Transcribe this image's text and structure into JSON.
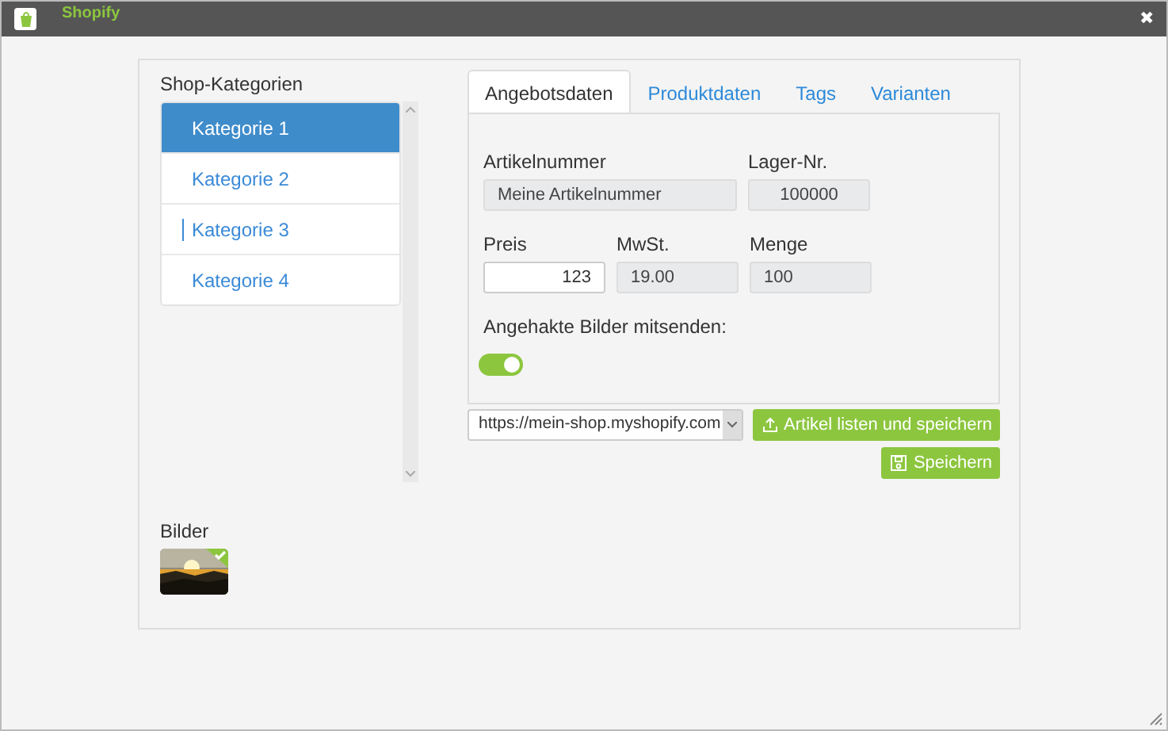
{
  "window": {
    "title": "Shopify",
    "close": "✖"
  },
  "categories": {
    "title": "Shop-Kategorien",
    "items": [
      {
        "label": "Kategorie 1",
        "selected": true,
        "cursor": false
      },
      {
        "label": "Kategorie 2",
        "selected": false,
        "cursor": false
      },
      {
        "label": "Kategorie 3",
        "selected": false,
        "cursor": true
      },
      {
        "label": "Kategorie 4",
        "selected": false,
        "cursor": false
      }
    ]
  },
  "images": {
    "title": "Bilder",
    "items": [
      {
        "kind": "picture",
        "checked": true
      }
    ]
  },
  "tabs": [
    {
      "label": "Angebotsdaten",
      "selected": true
    },
    {
      "label": "Produktdaten",
      "selected": false
    },
    {
      "label": "Tags",
      "selected": false
    },
    {
      "label": "Varianten",
      "selected": false
    }
  ],
  "fields": [
    [
      {
        "label": "Artikelnummer",
        "value": "Meine Artikelnummer",
        "disabled": true
      },
      {
        "label": "Lager-Nr.",
        "value": "100000",
        "disabled": true
      }
    ],
    [
      {
        "label": "Preis",
        "value": "123",
        "disabled": false
      },
      {
        "label": "MwSt.",
        "value": "19.00",
        "disabled": true
      },
      {
        "label": "Menge",
        "value": "100",
        "disabled": true
      }
    ]
  ],
  "send_images": {
    "label": "Angehakte Bilder mitsenden:",
    "on": true
  },
  "shop_select": {
    "value": "https://mein-shop.myshopify.com"
  },
  "buttons": [
    {
      "label": "Artikel listen und speichern",
      "kind": "upload"
    },
    {
      "label": "Speichern",
      "kind": "save"
    }
  ]
}
